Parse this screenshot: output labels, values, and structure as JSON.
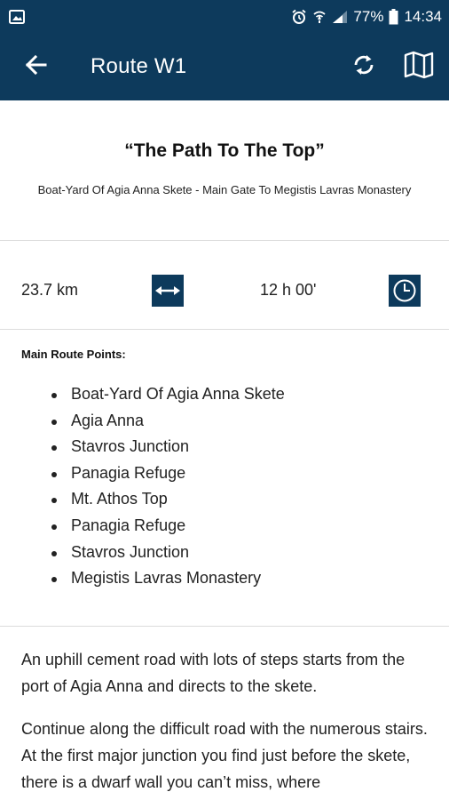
{
  "status_bar": {
    "battery": "77%",
    "time": "14:34",
    "icons": [
      "image-icon",
      "alarm-icon",
      "wifi-icon",
      "signal-icon",
      "battery-icon"
    ]
  },
  "app_bar": {
    "title": "Route W1",
    "icons": [
      "back-arrow-icon",
      "sync-icon",
      "map-icon"
    ]
  },
  "route": {
    "name": "“The Path To The Top”",
    "subtitle": "Boat-Yard Of Agia Anna Skete - Main Gate To Megistis Lavras Monastery",
    "distance": "23.7 km",
    "duration": "12 h 00'",
    "points_title": "Main Route Points:",
    "points": [
      "Boat-Yard Of Agia Anna Skete",
      "Agia Anna",
      "Stavros Junction",
      "Panagia Refuge",
      "Mt. Athos Top",
      "Panagia Refuge",
      "Stavros Junction",
      "Megistis Lavras Monastery"
    ],
    "description": [
      "An uphill cement road with lots of steps starts from the port of Agia Anna and directs to the skete.",
      "Continue along the difficult road with the numerous stairs. At the first major junction you find just before the skete, there is a dwarf wall you can’t miss, where"
    ]
  },
  "colors": {
    "primary": "#0d3a5c",
    "background": "#ffffff",
    "divider": "#dcdcdc"
  }
}
